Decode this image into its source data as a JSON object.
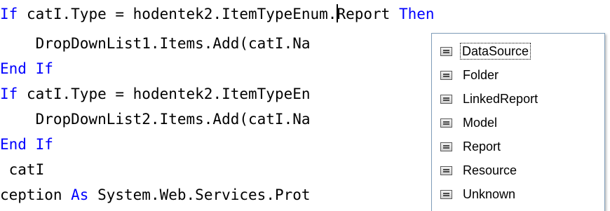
{
  "code": {
    "line1": {
      "kw_if": "If",
      "mid": " catI.Type = hodentek2.ItemTypeEnum.",
      "after_caret": "Report",
      "kw_then": "Then"
    },
    "line2": {
      "text": "    DropDownList1.Items.Add(catI.Na"
    },
    "line3": {
      "kw_end": "End",
      "kw_if": "If"
    },
    "line4": {
      "kw_if": "If",
      "text": " catI.Type = hodentek2.ItemTypeEn"
    },
    "line5": {
      "text": "    DropDownList2.Items.Add(catI.Na"
    },
    "line6": {
      "kw_end": "End",
      "kw_if": "If"
    },
    "line7": {
      "text": " catI"
    },
    "line8": {
      "pre": "ception ",
      "kw_as": "As",
      "post": " System.Web.Services.Prot"
    }
  },
  "completion_list": {
    "item_icon": "enum-member-icon",
    "selected_index": 0,
    "items": [
      {
        "label": "DataSource"
      },
      {
        "label": "Folder"
      },
      {
        "label": "LinkedReport"
      },
      {
        "label": "Model"
      },
      {
        "label": "Report"
      },
      {
        "label": "Resource"
      },
      {
        "label": "Unknown"
      }
    ]
  },
  "colors": {
    "keyword": "#0000ff",
    "code_text": "#000000",
    "list_border": "#7f9db9",
    "background": "#ffffff"
  }
}
